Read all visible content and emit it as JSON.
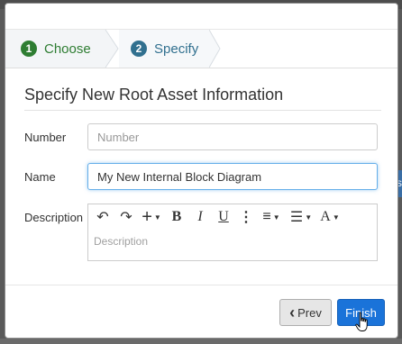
{
  "wizard": {
    "steps": [
      {
        "number": "1",
        "label": "Choose",
        "color": "#2e7d32",
        "state": "completed"
      },
      {
        "number": "2",
        "label": "Specify",
        "color": "#31708f",
        "state": "active"
      }
    ]
  },
  "form": {
    "title": "Specify New Root Asset Information",
    "number": {
      "label": "Number",
      "placeholder": "Number",
      "value": ""
    },
    "name": {
      "label": "Name",
      "value": "My New Internal Block Diagram"
    },
    "description": {
      "label": "Description",
      "placeholder": "Description"
    }
  },
  "editor": {
    "toolbar": {
      "undo": "↶",
      "redo": "↷",
      "insert": "+",
      "bold": "B",
      "italic": "I",
      "underline": "U",
      "more": "⋮",
      "align": "≡",
      "list": "☰",
      "font": "A"
    }
  },
  "footer": {
    "prev_label": "Prev",
    "prev_icon": "‹",
    "finish_label": "Finish"
  },
  "colors": {
    "primary": "#1a73d9",
    "focus": "#66afe9",
    "step_done": "#2e7d32",
    "step_active": "#31708f"
  },
  "background": {
    "right_button_letter": "s"
  }
}
